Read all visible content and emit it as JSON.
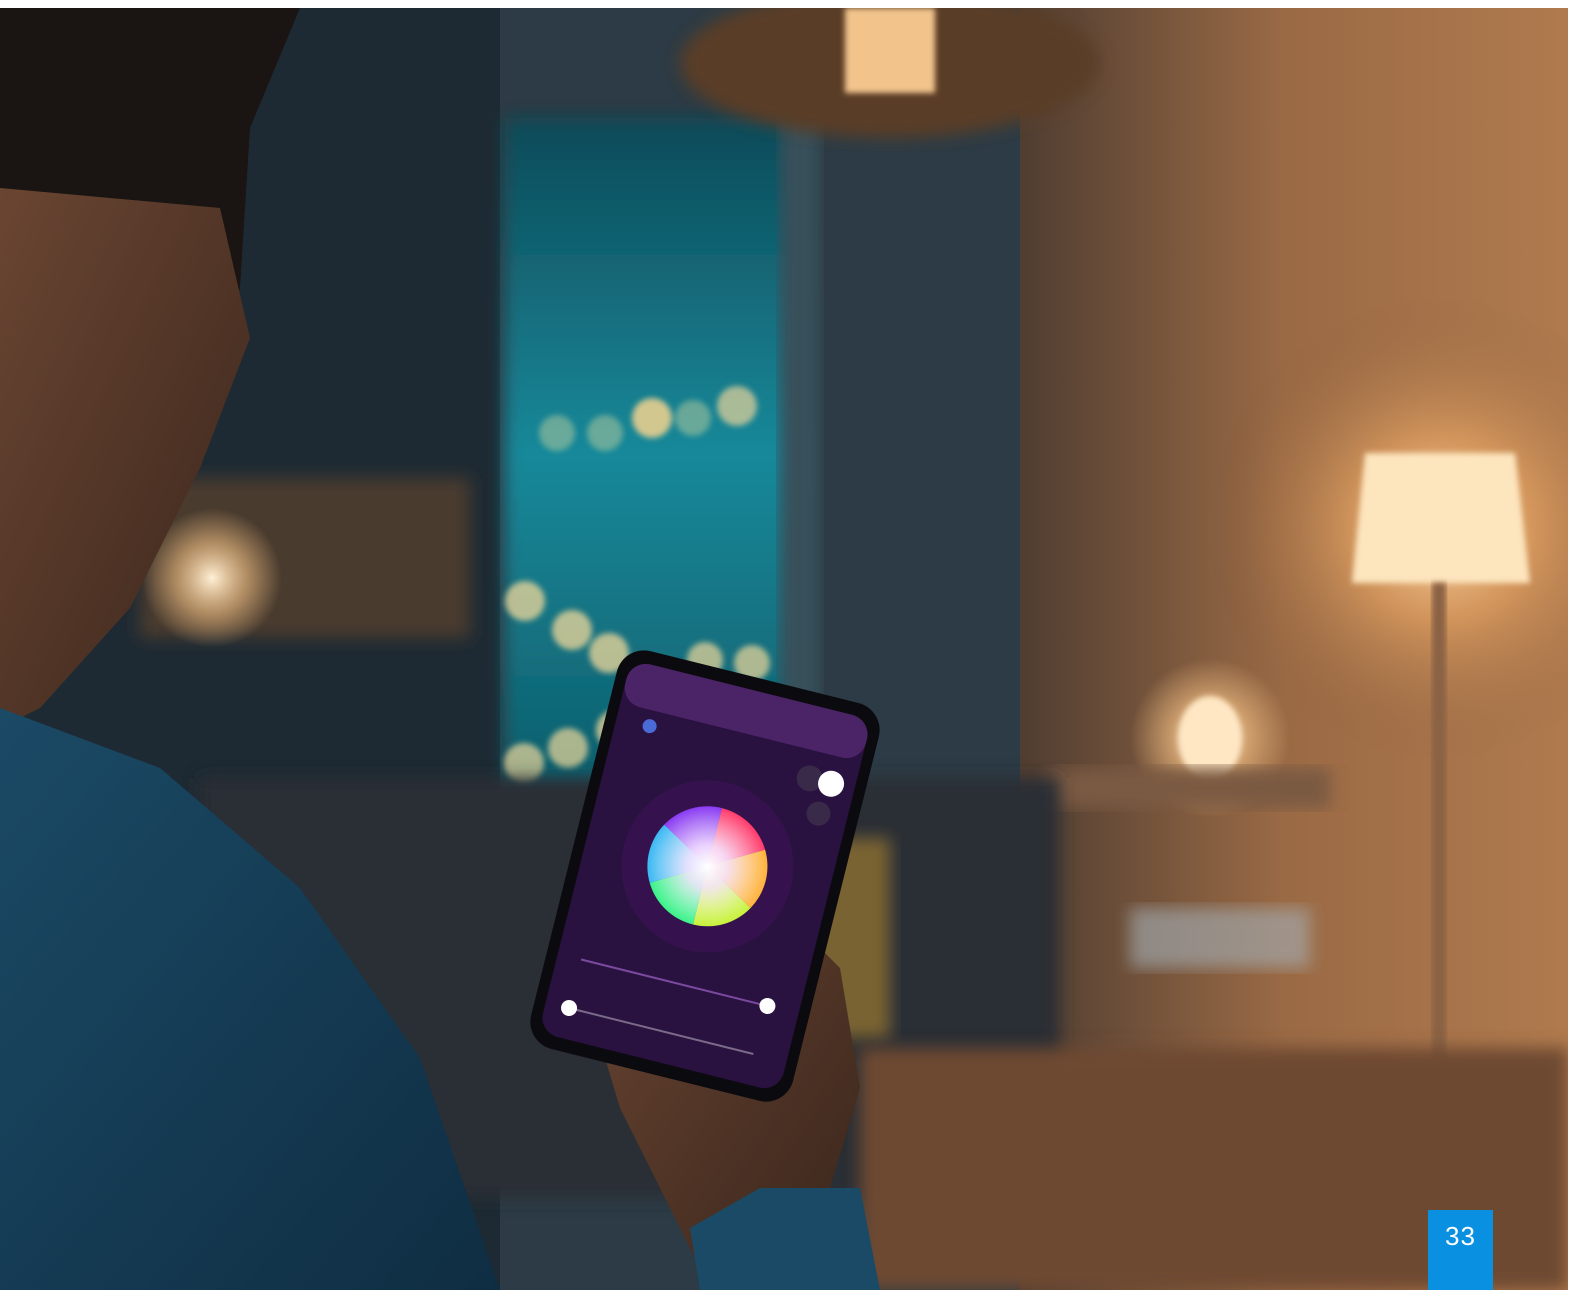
{
  "photo": {
    "description_tag": "smart-home-lighting-photo",
    "colors": {
      "room_dark": "#1d2730",
      "window_teal": "#1a8a9a",
      "lamp_warm": "#f6c98f",
      "app_bg": "#2a1240",
      "badge_blue": "#0a90e0"
    }
  },
  "page": {
    "number": "33"
  }
}
